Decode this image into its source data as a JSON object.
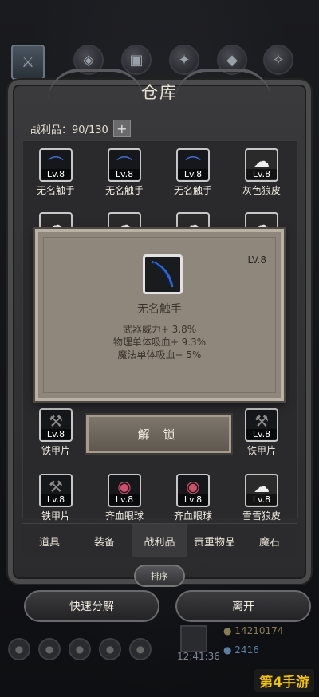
{
  "window": {
    "title": "仓库"
  },
  "inventory": {
    "label": "战利品：",
    "count": "90/130",
    "plus": "+"
  },
  "items_row1": [
    {
      "lv": "Lv.8",
      "name": "无名触手",
      "icon": "tentacle-icon"
    },
    {
      "lv": "Lv.8",
      "name": "无名触手",
      "icon": "tentacle-icon"
    },
    {
      "lv": "Lv.8",
      "name": "无名触手",
      "icon": "tentacle-icon"
    },
    {
      "lv": "Lv.8",
      "name": "灰色狼皮",
      "icon": "wolf-pelt-icon"
    }
  ],
  "items_row4": [
    {
      "lv": "Lv.8",
      "name": "铁甲片",
      "icon": "armor-shard-icon"
    },
    {
      "lv": "Lv.8",
      "name": "铁甲片",
      "icon": "armor-shard-icon"
    }
  ],
  "items_row5": [
    {
      "lv": "Lv.8",
      "name": "铁甲片",
      "icon": "armor-shard-icon"
    },
    {
      "lv": "Lv.8",
      "name": "齐血眼球",
      "icon": "eyeball-icon"
    },
    {
      "lv": "Lv.8",
      "name": "齐血眼球",
      "icon": "eyeball-icon"
    },
    {
      "lv": "Lv.8",
      "name": "雪雪狼皮",
      "icon": "wolf-pelt-icon"
    }
  ],
  "tooltip": {
    "lv": "LV.8",
    "name": "无名触手",
    "stats": [
      "武器威力+ 3.8%",
      "物理单体吸血+ 9.3%",
      "魔法单体吸血+ 5%"
    ]
  },
  "unlock_label": "解 锁",
  "tabs": [
    {
      "label": "道具",
      "active": false
    },
    {
      "label": "装备",
      "active": false
    },
    {
      "label": "战利品",
      "active": true
    },
    {
      "label": "贵重物品",
      "active": false
    },
    {
      "label": "魔石",
      "active": false
    }
  ],
  "sort_label": "排序",
  "quick_dismantle_label": "快速分解",
  "leave_label": "离开",
  "hud": {
    "time": "12:41:36",
    "gold": "14210174",
    "gems": "2416"
  },
  "brand": "第4手游",
  "colors": {
    "frame": "#4b4b4e",
    "tooltip": "#8f877c",
    "accent_text": "#e9e3d6"
  }
}
